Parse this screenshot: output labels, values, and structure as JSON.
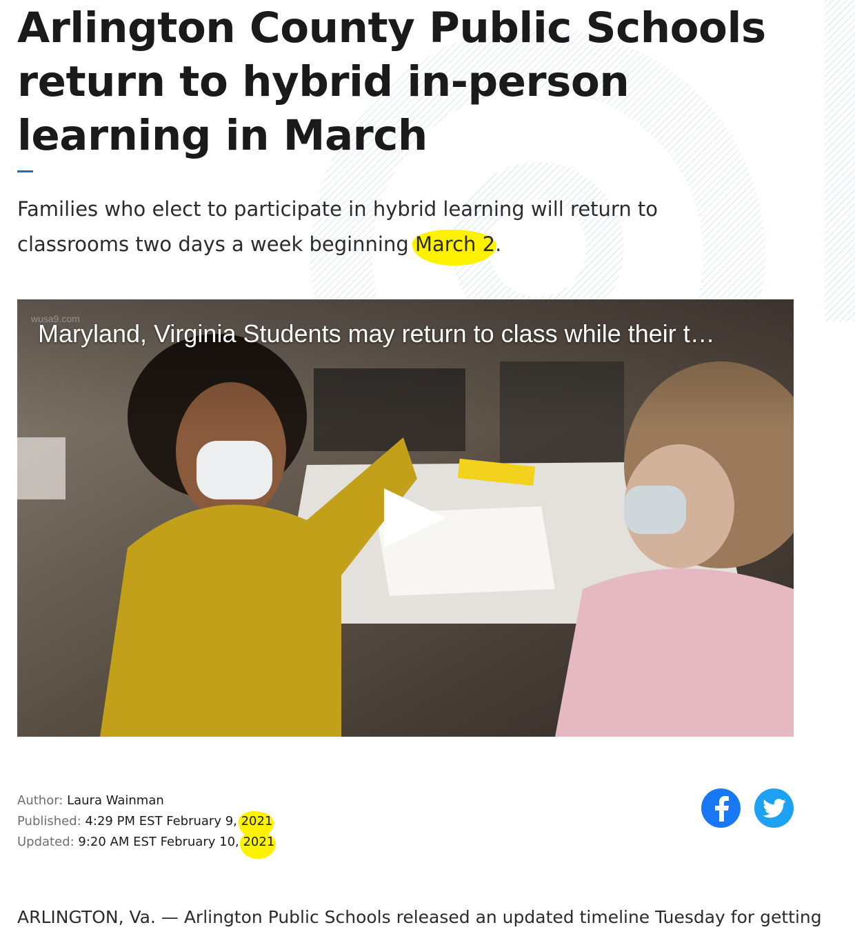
{
  "article": {
    "headline": "Arlington County Public Schools return to hybrid in-person learning in March",
    "dek_before": "Families who elect to participate in hybrid learning will return to classrooms two days a week beginning ",
    "dek_highlight": "March 2",
    "dek_after": ".",
    "body_first_line": "ARLINGTON, Va. — Arlington Public Schools released an updated timeline Tuesday for getting"
  },
  "video": {
    "title": "Maryland, Virginia Students may return to class while their t…",
    "watermark": "wusa9.com",
    "play_icon": "play-icon"
  },
  "meta": {
    "author_label": "Author: ",
    "author": "Laura Wainman",
    "published_label": "Published: ",
    "published_value": "4:29 PM EST February 9, ",
    "published_year": "2021",
    "updated_label": "Updated: ",
    "updated_value": "9:20 AM EST February 10, ",
    "updated_year": "2021"
  },
  "share": {
    "facebook_icon": "facebook-icon",
    "twitter_icon": "twitter-icon"
  },
  "colors": {
    "accent": "#1e6fb5",
    "highlight": "#fff200",
    "facebook": "#1877f2",
    "twitter": "#1da1f2"
  }
}
